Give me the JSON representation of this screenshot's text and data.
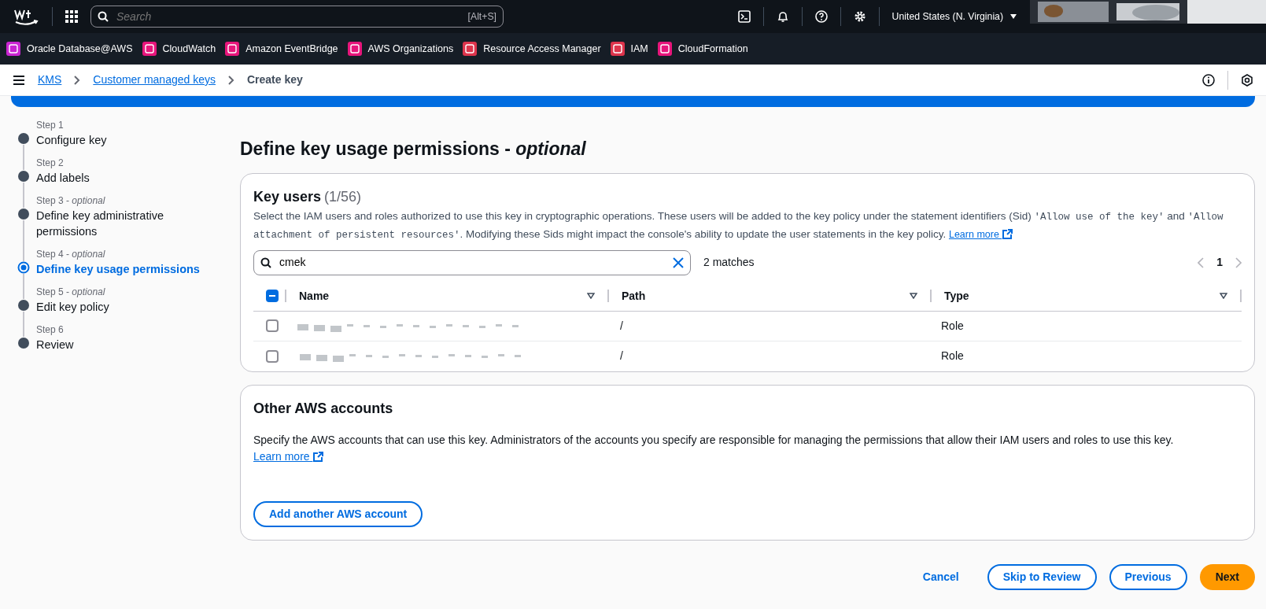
{
  "top_nav": {
    "search_placeholder": "Search",
    "shortcut": "[Alt+S]",
    "region": "United States (N. Virginia)"
  },
  "favorites": [
    {
      "label": "Oracle Database@AWS",
      "color": "#c925d1"
    },
    {
      "label": "CloudWatch",
      "color": "#e7157b"
    },
    {
      "label": "Amazon EventBridge",
      "color": "#e7157b"
    },
    {
      "label": "AWS Organizations",
      "color": "#e7157b"
    },
    {
      "label": "Resource Access Manager",
      "color": "#dd344c"
    },
    {
      "label": "IAM",
      "color": "#dd344c"
    },
    {
      "label": "CloudFormation",
      "color": "#e7157b"
    }
  ],
  "breadcrumbs": [
    {
      "label": "KMS",
      "link": true
    },
    {
      "label": "Customer managed keys",
      "link": true
    },
    {
      "label": "Create key",
      "link": false
    }
  ],
  "steps": [
    {
      "step": "Step 1",
      "title": "Configure key",
      "selected": false
    },
    {
      "step": "Step 2",
      "title": "Add labels",
      "selected": false
    },
    {
      "step": "Step 3 - *optional*",
      "title": "Define key administrative permissions",
      "selected": false
    },
    {
      "step": "Step 4 - *optional*",
      "title": "Define key usage permissions",
      "selected": true
    },
    {
      "step": "Step 5 - *optional*",
      "title": "Edit key policy",
      "selected": false
    },
    {
      "step": "Step 6",
      "title": "Review",
      "selected": false
    }
  ],
  "page_title": "Define key usage permissions - *optional*",
  "key_users": {
    "title": "Key users",
    "count": "(1/56)",
    "description": [
      {
        "text": "Select the IAM users and roles authorized to use this key in cryptographic operations. These users will be added to the key policy under the statement identifiers (Sid) ",
        "code": false
      },
      {
        "text": "'Allow use of the key'",
        "code": true
      },
      {
        "text": " and ",
        "code": false
      },
      {
        "text": "'Allow attachment of persistent resources'",
        "code": true
      },
      {
        "text": ". Modifying these Sids might impact the console's ability to update the user statements in the key policy. ",
        "code": false
      }
    ],
    "learn_more": "Learn more",
    "search": {
      "value": "cmek"
    },
    "matches": "2 matches",
    "page": "1",
    "select_all": {
      "indeterminate": true
    },
    "columns": [
      "Name",
      "Path",
      "Type"
    ],
    "rows": [
      {
        "path": "/",
        "type": "Role",
        "selected": false
      },
      {
        "path": "/",
        "type": "Role",
        "selected": false
      }
    ]
  },
  "other_accounts": {
    "title": "Other AWS accounts",
    "description": "Specify the AWS accounts that can use this key. Administrators of the accounts you specify are responsible for managing the permissions that allow their IAM users and roles to use this key.",
    "learn_more": "Learn more",
    "button": "Add another AWS account"
  },
  "footer_buttons": [
    {
      "label": "Cancel",
      "kind": "link"
    },
    {
      "label": "Skip to Review",
      "kind": "secondary"
    },
    {
      "label": "Previous",
      "kind": "secondary"
    },
    {
      "label": "Next",
      "kind": "primary"
    }
  ]
}
